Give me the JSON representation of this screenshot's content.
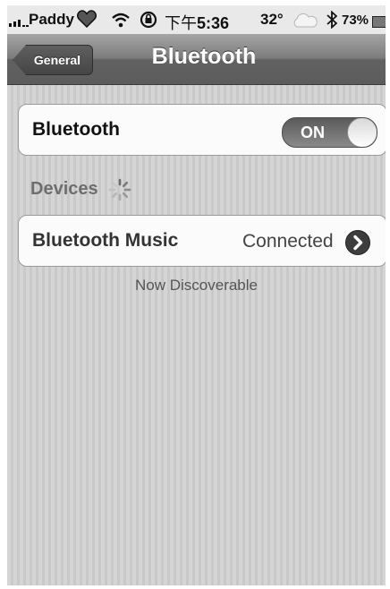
{
  "status_bar": {
    "carrier": "Paddy",
    "time_prefix": "下午",
    "time": "5:36",
    "temperature": "32°",
    "battery_percent": "73%"
  },
  "nav": {
    "back_label": "General",
    "title": "Bluetooth"
  },
  "bluetooth_toggle": {
    "label": "Bluetooth",
    "state_label": "ON"
  },
  "devices_section": {
    "header": "Devices",
    "items": [
      {
        "name": "Bluetooth Music",
        "status": "Connected"
      }
    ]
  },
  "footer_text": "Now Discoverable",
  "icons": [
    "signal-bars-icon",
    "heart-icon",
    "wifi-icon",
    "rotation-lock-icon",
    "cloud-icon",
    "bluetooth-icon",
    "battery-icon",
    "activity-spinner-icon",
    "disclosure-chevron-icon"
  ]
}
